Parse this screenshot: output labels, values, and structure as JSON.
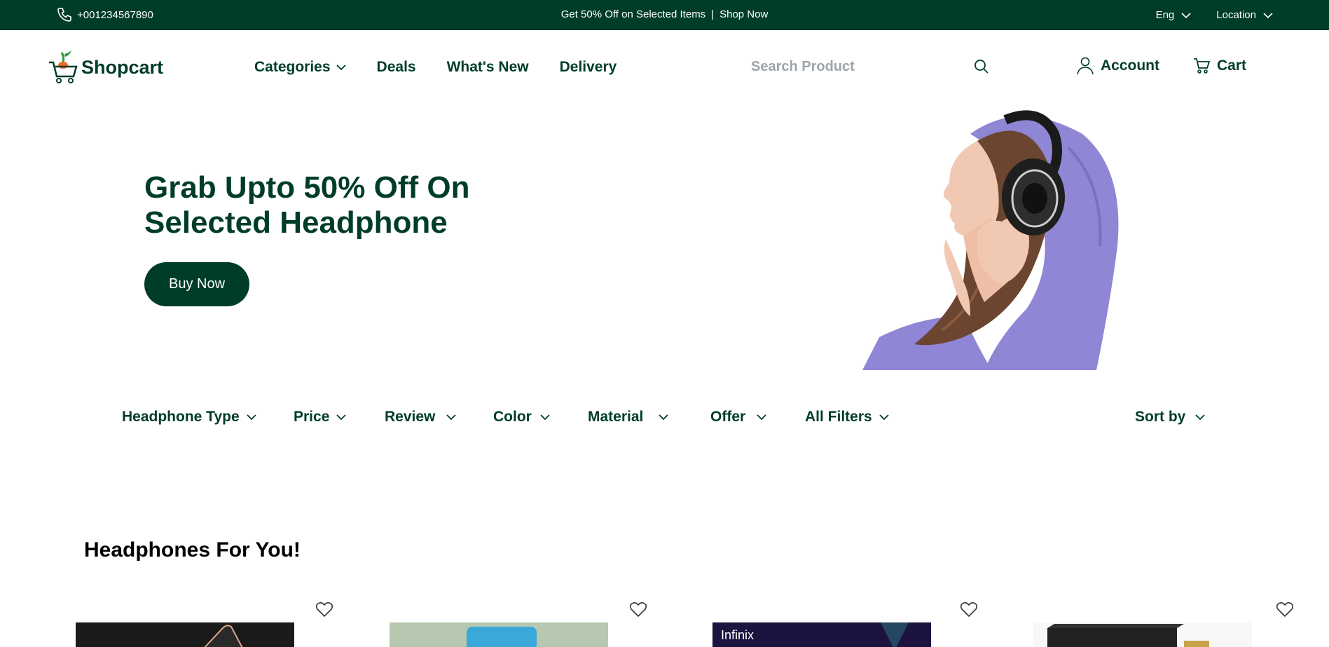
{
  "topbar": {
    "phone": "+001234567890",
    "promo_text": "Get 50% Off on Selected Items",
    "separator": "|",
    "promo_link": "Shop Now",
    "language": "Eng",
    "location": "Location"
  },
  "header": {
    "logo_text": "Shopcart",
    "nav": [
      "Categories",
      "Deals",
      "What's New",
      "Delivery"
    ],
    "search_placeholder": "Search Product",
    "account_label": "Account",
    "cart_label": "Cart"
  },
  "hero": {
    "headline_line1": "Grab Upto 50% Off On",
    "headline_line2": "Selected Headphone",
    "button_label": "Buy Now",
    "image_subject": "woman wearing headphones in lavender hoodie"
  },
  "filters": {
    "items": [
      "Headphone Type",
      "Price",
      "Review",
      "Color",
      "Material",
      "Offer",
      "All Filters"
    ],
    "sort_label": "Sort by"
  },
  "section": {
    "title": "Headphones For You!"
  },
  "products": [
    {
      "thumb_color": "#1a1a1a"
    },
    {
      "thumb_color": "#3aa8d8"
    },
    {
      "thumb_color": "#1c1340",
      "brand_text": "Infinix"
    },
    {
      "thumb_color": "#222222"
    }
  ],
  "colors": {
    "brand": "#003d29",
    "placeholder": "#9ea4ad",
    "hoodie": "#8f86d6"
  }
}
